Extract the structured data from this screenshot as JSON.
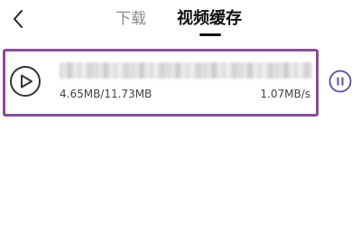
{
  "header": {
    "back_icon": "chevron-left-icon",
    "tabs": [
      {
        "label": "下载",
        "active": false
      },
      {
        "label": "视频缓存",
        "active": true
      }
    ]
  },
  "task": {
    "title": "",
    "progress_text": "4.65MB/11.73MB",
    "downloaded": "4.65MB",
    "total": "11.73MB",
    "progress_fraction": 0.396,
    "speed": "1.07MB/s",
    "play_icon": "play-circle-icon",
    "pause_icon": "pause-circle-icon",
    "highlight_color": "#8c4a9a",
    "accent_color": "#5a4bb0"
  }
}
